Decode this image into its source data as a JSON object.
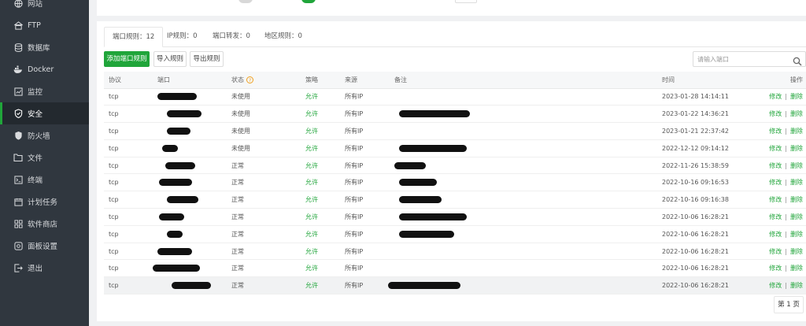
{
  "sidebar": {
    "items": [
      {
        "label": "网站",
        "icon": "globe-icon"
      },
      {
        "label": "FTP",
        "icon": "ftp-icon"
      },
      {
        "label": "数据库",
        "icon": "database-icon"
      },
      {
        "label": "Docker",
        "icon": "docker-icon"
      },
      {
        "label": "监控",
        "icon": "monitor-icon"
      },
      {
        "label": "安全",
        "icon": "shield-check-icon",
        "active": true
      },
      {
        "label": "防火墙",
        "icon": "firewall-icon"
      },
      {
        "label": "文件",
        "icon": "folder-icon"
      },
      {
        "label": "终端",
        "icon": "terminal-icon"
      },
      {
        "label": "计划任务",
        "icon": "calendar-icon"
      },
      {
        "label": "软件商店",
        "icon": "grid-icon"
      },
      {
        "label": "面板设置",
        "icon": "settings-icon"
      },
      {
        "label": "退出",
        "icon": "logout-icon"
      }
    ]
  },
  "tabs": [
    "端口规则：12",
    "IP规则：0",
    "端口转发：0",
    "地区规则：0"
  ],
  "toolbar": {
    "add_label": "添加端口规则",
    "import_label": "导入规则",
    "export_label": "导出规则"
  },
  "search": {
    "placeholder": "请输入端口"
  },
  "table": {
    "headers": {
      "protocol": "协议",
      "port": "端口",
      "status": "状态",
      "policy": "策略",
      "source": "来源",
      "remark": "备注",
      "time": "时间",
      "actions": "操作"
    },
    "rows": [
      {
        "protocol": "tcp",
        "status": "未使用",
        "policy": "允许",
        "source": "所有IP",
        "time": "2023-01-28 14:14:11"
      },
      {
        "protocol": "tcp",
        "status": "未使用",
        "policy": "允许",
        "source": "所有IP",
        "time": "2023-01-22 14:36:21"
      },
      {
        "protocol": "tcp",
        "status": "未使用",
        "policy": "允许",
        "source": "所有IP",
        "time": "2023-01-21 22:37:42"
      },
      {
        "protocol": "tcp",
        "status": "未使用",
        "policy": "允许",
        "source": "所有IP",
        "time": "2022-12-12 09:14:12"
      },
      {
        "protocol": "tcp",
        "status": "正常",
        "policy": "允许",
        "source": "所有IP",
        "time": "2022-11-26 15:38:59"
      },
      {
        "protocol": "tcp",
        "status": "正常",
        "policy": "允许",
        "source": "所有IP",
        "time": "2022-10-16 09:16:53"
      },
      {
        "protocol": "tcp",
        "status": "正常",
        "policy": "允许",
        "source": "所有IP",
        "time": "2022-10-16 09:16:38"
      },
      {
        "protocol": "tcp",
        "status": "正常",
        "policy": "允许",
        "source": "所有IP",
        "time": "2022-10-06 16:28:21"
      },
      {
        "protocol": "tcp",
        "status": "正常",
        "policy": "允许",
        "source": "所有IP",
        "time": "2022-10-06 16:28:21"
      },
      {
        "protocol": "tcp",
        "status": "正常",
        "policy": "允许",
        "source": "所有IP",
        "time": "2022-10-06 16:28:21"
      },
      {
        "protocol": "tcp",
        "status": "正常",
        "policy": "允许",
        "source": "所有IP",
        "time": "2022-10-06 16:28:21"
      },
      {
        "protocol": "tcp",
        "status": "正常",
        "policy": "允许",
        "source": "所有IP",
        "time": "2022-10-06 16:28:21"
      }
    ],
    "edit_label": "修改",
    "separator": "|",
    "delete_label": "删除"
  },
  "pagination": {
    "page_label": "第 1 页"
  },
  "colors": {
    "accent": "#20a53a",
    "sidebar_bg": "#30373f",
    "warning": "#f0a020"
  }
}
